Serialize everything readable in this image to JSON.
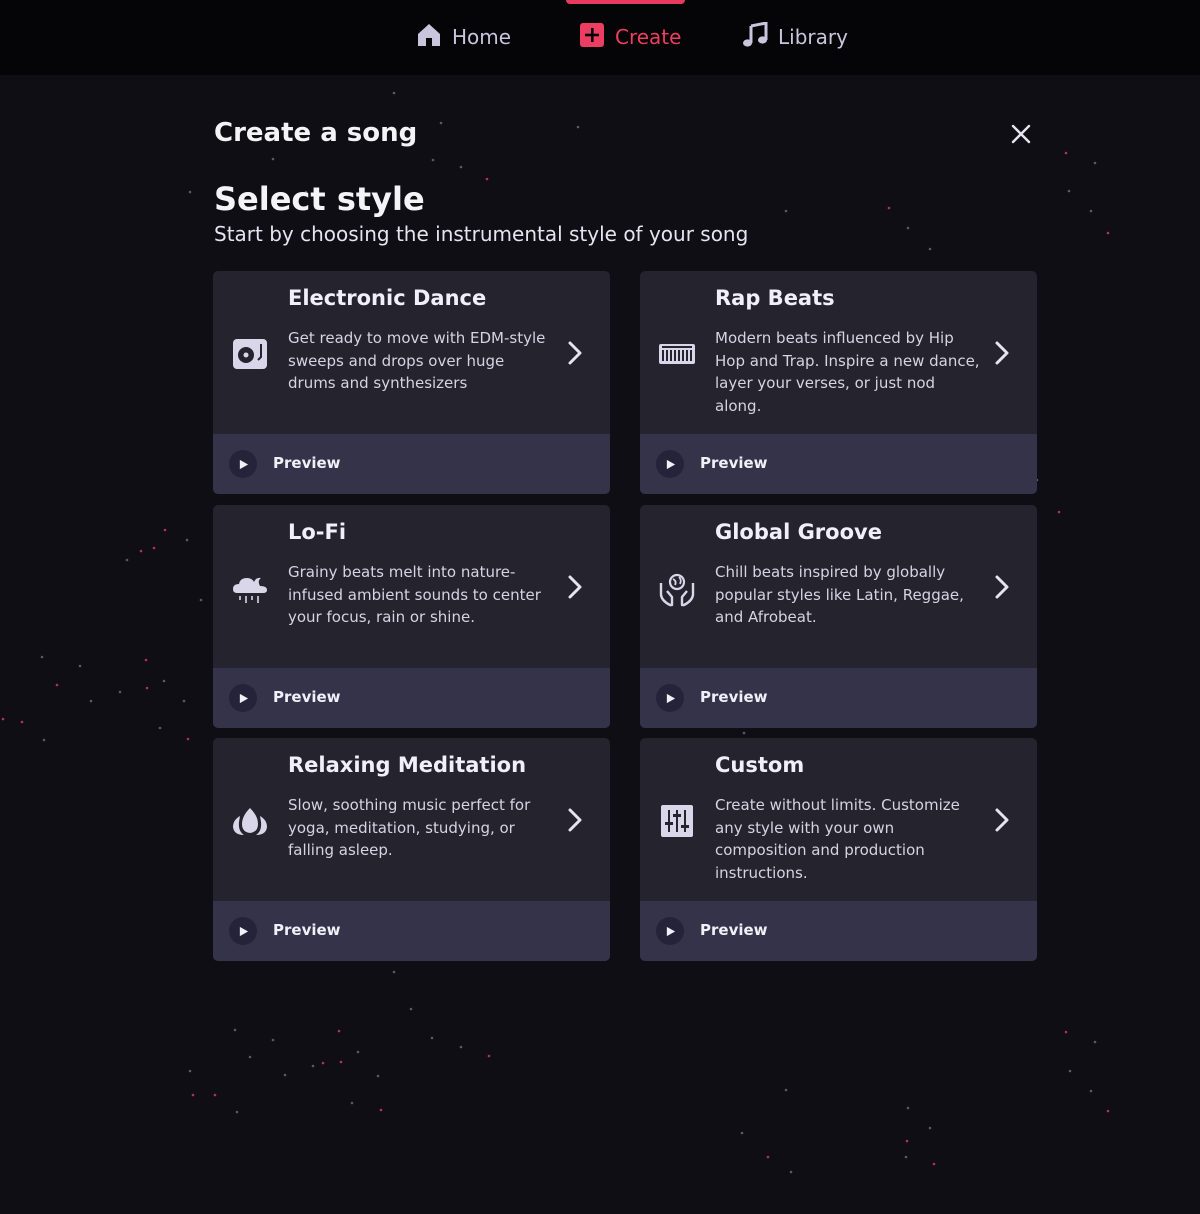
{
  "nav": {
    "items": [
      {
        "label": "Home",
        "icon": "home-icon"
      },
      {
        "label": "Create",
        "icon": "plus-square-icon",
        "active": true
      },
      {
        "label": "Library",
        "icon": "music-note-icon"
      }
    ]
  },
  "modal": {
    "title": "Create a song",
    "close_icon": "close-icon",
    "section_title": "Select style",
    "section_subtitle": "Start by choosing the instrumental style of your song"
  },
  "styles": [
    {
      "title": "Electronic Dance",
      "description": "Get ready to move with EDM-style sweeps and drops over huge drums and synthesizers",
      "icon": "turntable-icon",
      "preview_label": "Preview"
    },
    {
      "title": "Rap Beats",
      "description": "Modern beats influenced by Hip Hop and Trap. Inspire a new dance, layer your verses, or just nod along.",
      "icon": "keyboard-icon",
      "preview_label": "Preview"
    },
    {
      "title": "Lo-Fi",
      "description": "Grainy beats melt into nature-infused ambient sounds to center your focus, rain or shine.",
      "icon": "rain-cloud-icon",
      "preview_label": "Preview"
    },
    {
      "title": "Global Groove",
      "description": "Chill beats inspired by globally popular styles like Latin, Reggae, and Afrobeat.",
      "icon": "globe-hands-icon",
      "preview_label": "Preview"
    },
    {
      "title": "Relaxing Meditation",
      "description": "Slow, soothing music perfect for yoga, meditation, studying, or falling asleep.",
      "icon": "lotus-icon",
      "preview_label": "Preview"
    },
    {
      "title": "Custom",
      "description": "Create without limits. Customize any style with your own composition and production instructions.",
      "icon": "sliders-icon",
      "preview_label": "Preview"
    }
  ],
  "colors": {
    "background": "#0f0e14",
    "nav_background": "#050507",
    "accent": "#e73a5e",
    "card": "#24232e",
    "card_footer": "#34334a",
    "icon": "#d9d6ea"
  }
}
